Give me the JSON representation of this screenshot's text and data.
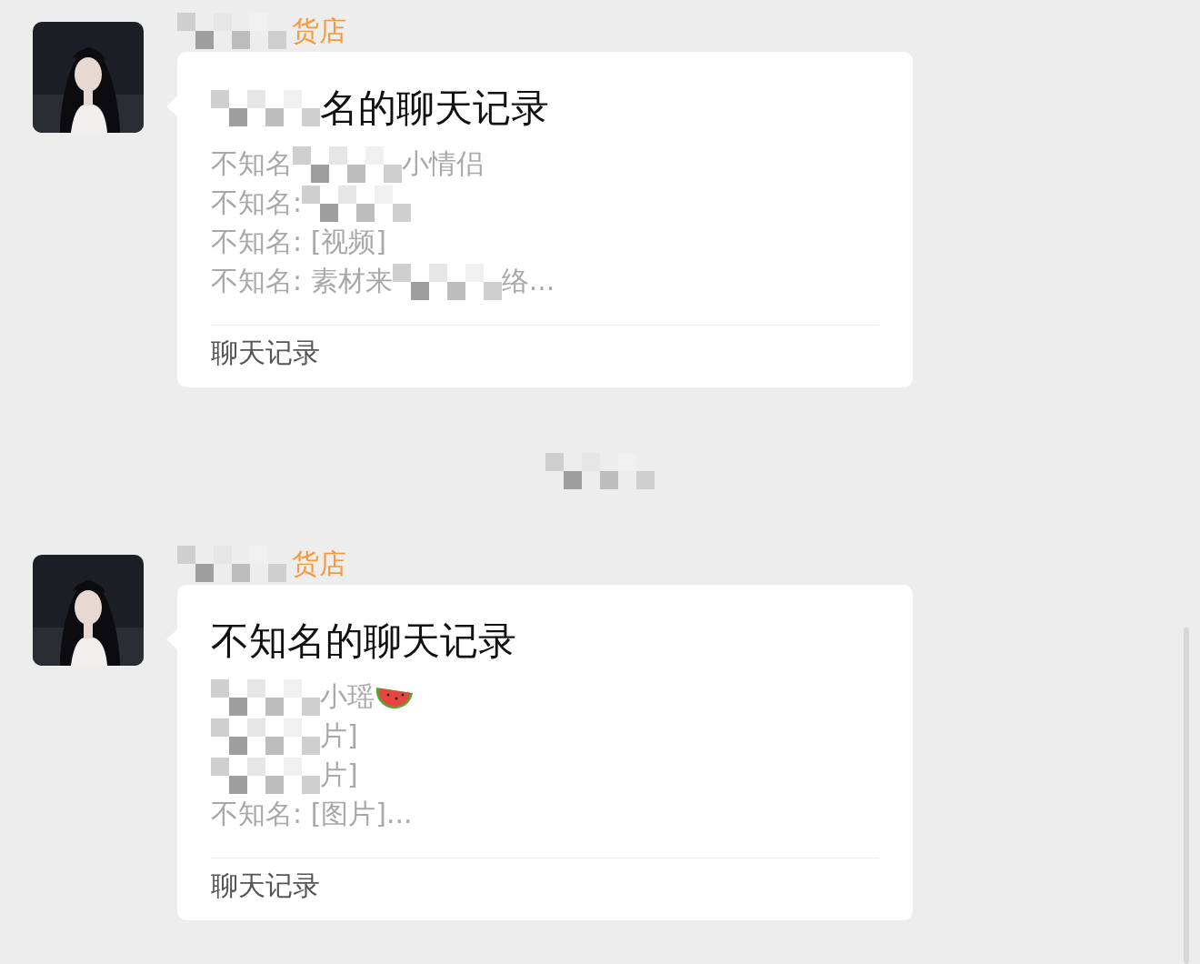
{
  "messages": [
    {
      "sender": [
        {
          "kind": "mosaic"
        },
        {
          "kind": "text",
          "text": "货店"
        }
      ],
      "card": {
        "title": [
          {
            "kind": "mosaic"
          },
          {
            "kind": "text",
            "text": "名的聊天记录"
          }
        ],
        "lines": [
          [
            {
              "kind": "text",
              "text": "不知名"
            },
            {
              "kind": "mosaic"
            },
            {
              "kind": "text",
              "text": "小情侣"
            }
          ],
          [
            {
              "kind": "text",
              "text": "不知名:"
            },
            {
              "kind": "mosaic"
            }
          ],
          [
            {
              "kind": "text",
              "text": "不知名: [视频]"
            }
          ],
          [
            {
              "kind": "text",
              "text": "不知名: 素材来"
            },
            {
              "kind": "mosaic"
            },
            {
              "kind": "text",
              "text": "络..."
            }
          ]
        ],
        "footer": "聊天记录"
      }
    },
    {
      "sender": [
        {
          "kind": "mosaic"
        },
        {
          "kind": "text",
          "text": "货店"
        }
      ],
      "card": {
        "title": [
          {
            "kind": "text",
            "text": "不知名的聊天记录"
          }
        ],
        "lines": [
          [
            {
              "kind": "mosaic"
            },
            {
              "kind": "text",
              "text": "小瑶"
            },
            {
              "kind": "watermelon"
            }
          ],
          [
            {
              "kind": "mosaic"
            },
            {
              "kind": "text",
              "text": "片]"
            }
          ],
          [
            {
              "kind": "mosaic"
            },
            {
              "kind": "text",
              "text": "片]"
            }
          ],
          [
            {
              "kind": "text",
              "text": "不知名: [图片]..."
            }
          ]
        ],
        "footer": "聊天记录"
      }
    }
  ]
}
